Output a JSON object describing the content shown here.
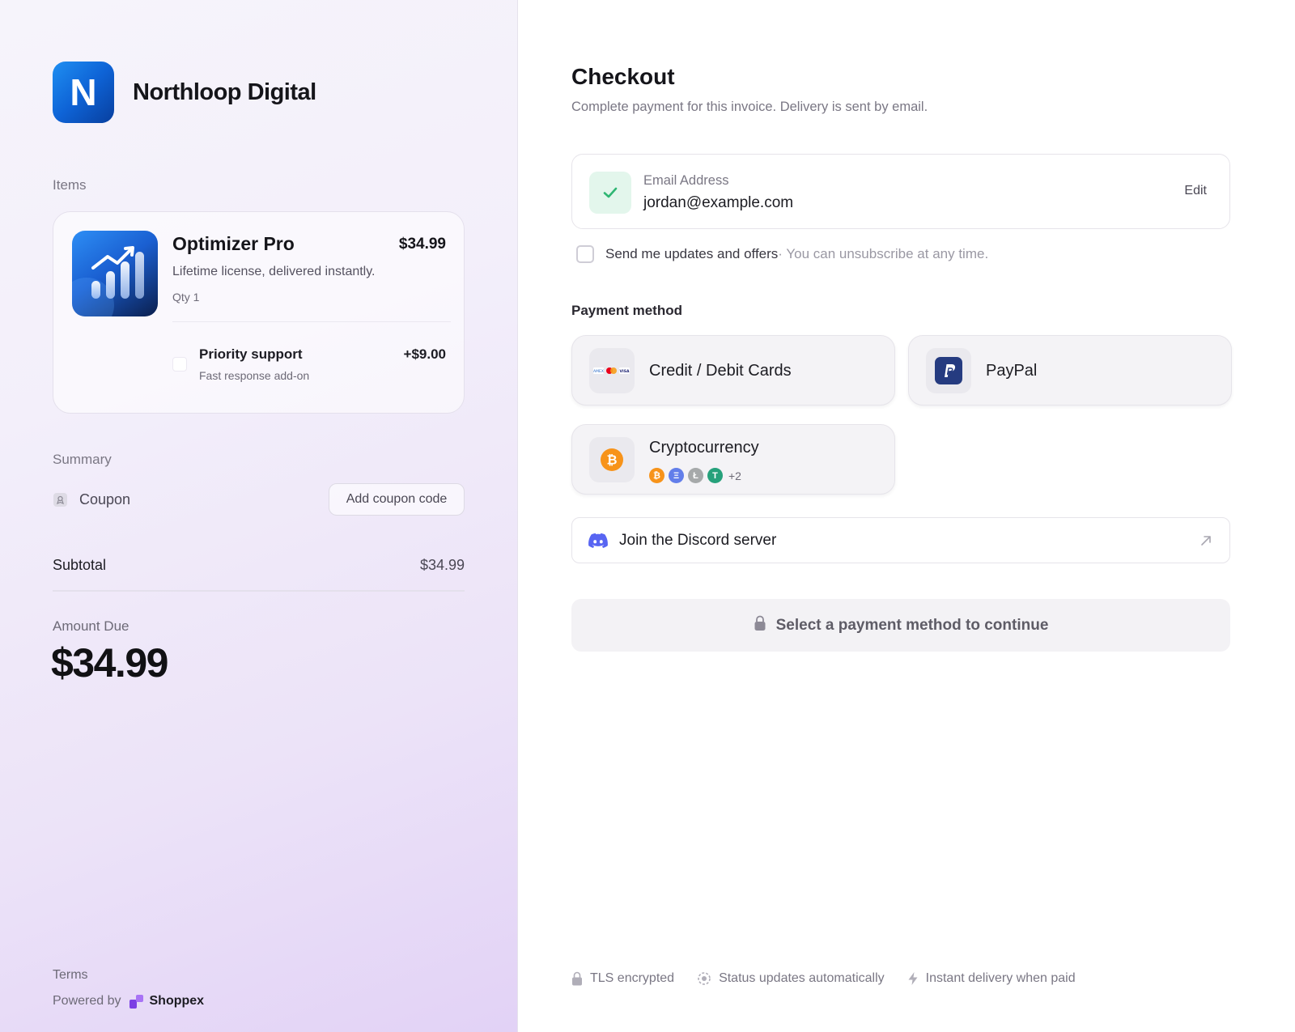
{
  "brand": {
    "name": "Northloop Digital",
    "logo_letter": "N"
  },
  "items": {
    "section_label": "Items",
    "product": {
      "name": "Optimizer Pro",
      "price": "$34.99",
      "description": "Lifetime license, delivered instantly.",
      "qty": "Qty 1"
    },
    "addon": {
      "name": "Priority support",
      "price": "+$9.00",
      "description": "Fast response add-on",
      "checked": false
    }
  },
  "summary": {
    "section_label": "Summary",
    "coupon_label": "Coupon",
    "coupon_button": "Add coupon code",
    "subtotal_label": "Subtotal",
    "subtotal_value": "$34.99",
    "amount_due_label": "Amount Due",
    "amount_due_value": "$34.99"
  },
  "left_footer": {
    "terms": "Terms",
    "powered_by": "Powered by",
    "platform": "Shoppex"
  },
  "checkout": {
    "title": "Checkout",
    "subtitle": "Complete payment for this invoice. Delivery is sent by email.",
    "email": {
      "label": "Email Address",
      "value": "jordan@example.com",
      "edit_label": "Edit"
    },
    "updates": {
      "label": "Send me updates and offers",
      "note": " · You can unsubscribe at any time.",
      "checked": false
    },
    "payment_method_label": "Payment method",
    "payment_methods": [
      {
        "name": "Credit / Debit Cards",
        "icon": "cards-icon"
      },
      {
        "name": "PayPal",
        "icon": "paypal-icon"
      },
      {
        "name": "Cryptocurrency",
        "icon": "bitcoin-icon",
        "coins": [
          "₿",
          "Ξ",
          "Ł",
          "T"
        ],
        "more": "+2"
      }
    ],
    "discord_label": "Join the Discord server",
    "cta_label": "Select a payment method to continue"
  },
  "footer": {
    "tls": "TLS encrypted",
    "status": "Status updates automatically",
    "delivery": "Instant delivery when paid"
  },
  "colors": {
    "brand_blue": "#1f8ff2",
    "success_green": "#2fb673",
    "paypal_navy": "#253b80",
    "bitcoin_orange": "#f7931a",
    "discord_blurple": "#5865f2",
    "shoppex_purple": "#7b3fe4"
  }
}
